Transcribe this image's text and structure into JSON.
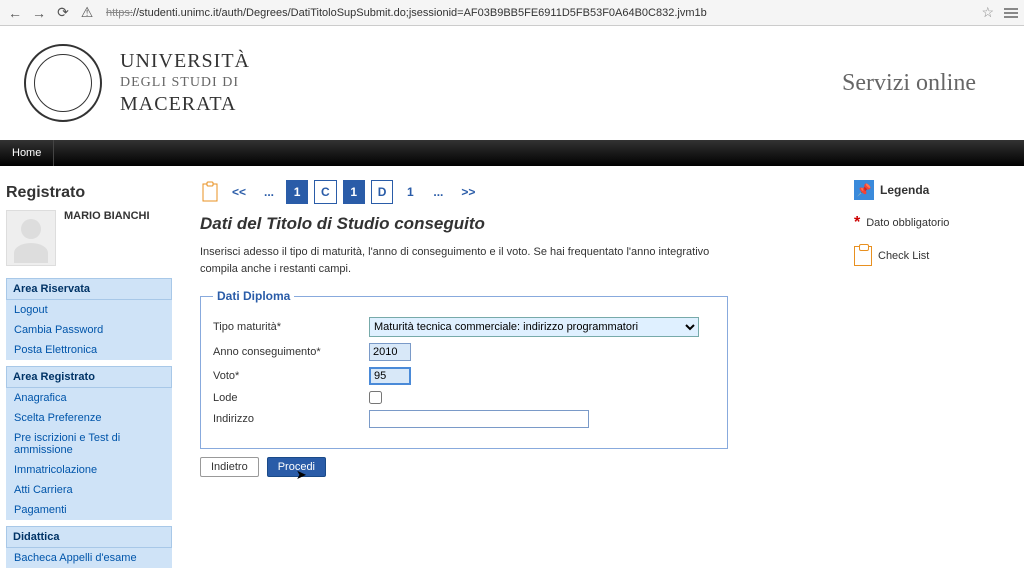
{
  "browser": {
    "url_scheme": "https:",
    "url_rest": "//studenti.unimc.it/auth/Degrees/DatiTitoloSupSubmit.do;jsessionid=AF03B9BB5FE6911D5FB53F0A64B0C832.jvm1b"
  },
  "header": {
    "line1": "UNIVERSITÀ",
    "line2": "DEGLI STUDI DI",
    "line3": "MACERATA",
    "servizi": "Servizi online"
  },
  "navbar": {
    "home": "Home"
  },
  "sidebar": {
    "title": "Registrato",
    "user_name": "MARIO BIANCHI",
    "sections": {
      "riservata": "Area Riservata",
      "riservata_items": [
        "Logout",
        "Cambia Password",
        "Posta Elettronica"
      ],
      "registrato": "Area Registrato",
      "registrato_items": [
        "Anagrafica",
        "Scelta Preferenze",
        "Pre iscrizioni e Test di ammissione",
        "Immatricolazione",
        "Atti Carriera",
        "Pagamenti"
      ],
      "didattica": "Didattica",
      "didattica_items": [
        "Bacheca Appelli d'esame"
      ]
    }
  },
  "steps": {
    "prev": "<<",
    "dots1": "...",
    "s1": "1",
    "sC": "C",
    "s1b": "1",
    "sD": "D",
    "s1c": "1",
    "dots2": "...",
    "next": ">>"
  },
  "main": {
    "title": "Dati del Titolo di Studio conseguito",
    "intro": "Inserisci adesso il tipo di maturità, l'anno di conseguimento e il voto. Se hai frequentato l'anno integrativo compila anche i restanti campi.",
    "fieldset_legend": "Dati Diploma",
    "labels": {
      "tipo": "Tipo maturità*",
      "anno": "Anno conseguimento*",
      "voto": "Voto*",
      "lode": "Lode",
      "indirizzo": "Indirizzo"
    },
    "values": {
      "tipo_option": "Maturità tecnica commerciale: indirizzo programmatori",
      "anno": "2010",
      "voto": "95",
      "indirizzo": ""
    },
    "buttons": {
      "back": "Indietro",
      "proceed": "Procedi"
    }
  },
  "legend": {
    "title": "Legenda",
    "required": "Dato obbligatorio",
    "checklist": "Check List"
  }
}
